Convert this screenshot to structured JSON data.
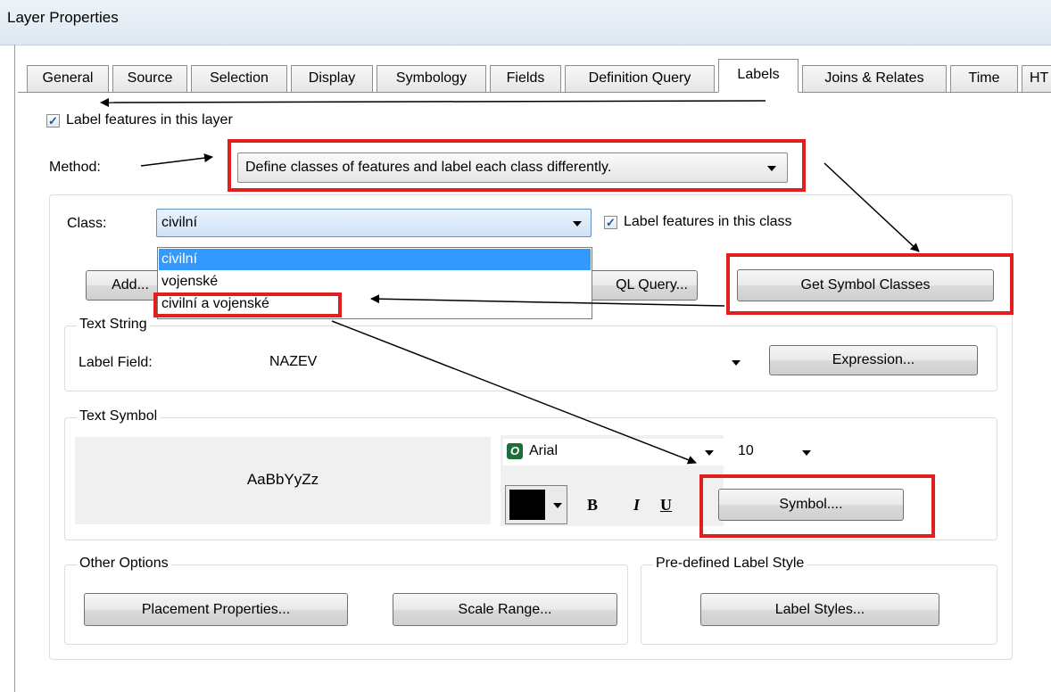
{
  "window": {
    "title": "Layer Properties"
  },
  "tabs": [
    {
      "label": "General"
    },
    {
      "label": "Source"
    },
    {
      "label": "Selection"
    },
    {
      "label": "Display"
    },
    {
      "label": "Symbology"
    },
    {
      "label": "Fields"
    },
    {
      "label": "Definition Query"
    },
    {
      "label": "Labels"
    },
    {
      "label": "Joins & Relates"
    },
    {
      "label": "Time"
    },
    {
      "label": "HT"
    }
  ],
  "labels_tab": {
    "label_features_layer": "Label features in this layer",
    "label_features_layer_checked": true,
    "method_label": "Method:",
    "method_value": "Define classes of features and label each class differently.",
    "class_label": "Class:",
    "class_value": "civilní",
    "class_options": [
      "civilní",
      "vojenské",
      "civilní a vojenské"
    ],
    "label_features_class": "Label features in this class",
    "label_features_class_checked": true,
    "add_button": "Add...",
    "sql_query_button": "QL Query...",
    "get_symbol_classes_button": "Get Symbol Classes",
    "text_string": {
      "group_label": "Text String",
      "label_field_label": "Label Field:",
      "label_field_value": "NAZEV",
      "expression_button": "Expression..."
    },
    "text_symbol": {
      "group_label": "Text Symbol",
      "preview_text": "AaBbYyZz",
      "font_icon_glyph": "O",
      "font_name": "Arial",
      "font_size": "10",
      "bold_label": "B",
      "italic_label": "I",
      "underline_label": "U",
      "symbol_button": "Symbol....",
      "font_color": "#000000"
    },
    "other_options": {
      "group_label": "Other Options",
      "placement_button": "Placement Properties...",
      "scale_range_button": "Scale Range..."
    },
    "predefined_style": {
      "group_label": "Pre-defined Label Style",
      "label_styles_button": "Label Styles..."
    }
  },
  "annotation_color": "#e02020",
  "check_glyph": "✓"
}
